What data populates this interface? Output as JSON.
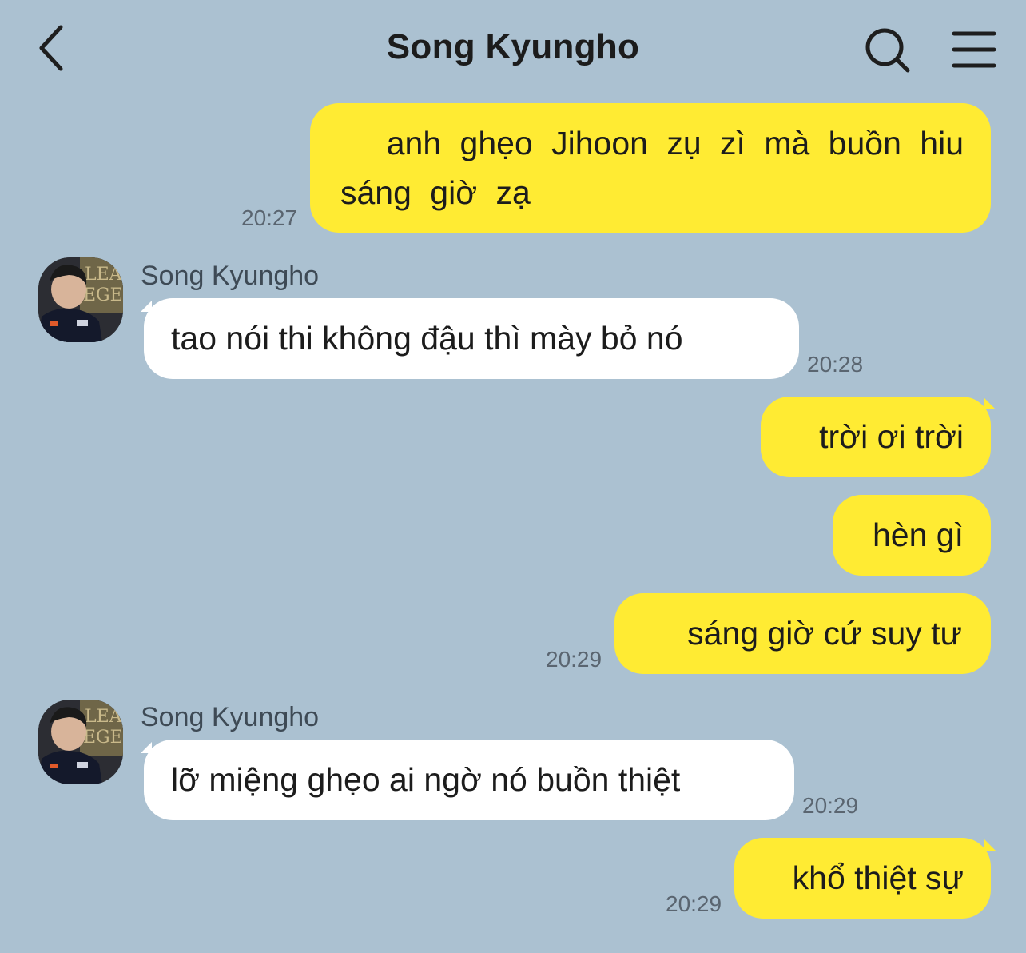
{
  "header": {
    "title": "Song Kyungho",
    "back_icon": "chevron-left-icon",
    "search_icon": "search-icon",
    "menu_icon": "hamburger-menu-icon"
  },
  "colors": {
    "background": "#abc1d1",
    "outgoing_bubble": "#ffeb33",
    "incoming_bubble": "#ffffff"
  },
  "messages": [
    {
      "direction": "out",
      "text": "anh ghẹo Jihoon zụ zì mà buồn hiu sáng giờ zạ",
      "time": "20:27"
    },
    {
      "direction": "in",
      "sender": "Song Kyungho",
      "text": "tao nói thi không đậu thì mày bỏ nó",
      "time": "20:28"
    },
    {
      "direction": "out",
      "text": "trời ơi trời",
      "time": ""
    },
    {
      "direction": "out",
      "text": "hèn gì",
      "time": ""
    },
    {
      "direction": "out",
      "text": "sáng giờ cứ suy tư",
      "time": "20:29"
    },
    {
      "direction": "in",
      "sender": "Song Kyungho",
      "text": "lỡ miệng ghẹo ai ngờ nó buồn thiệt",
      "time": "20:29"
    },
    {
      "direction": "out",
      "text": "khổ thiệt sự",
      "time": "20:29"
    }
  ]
}
